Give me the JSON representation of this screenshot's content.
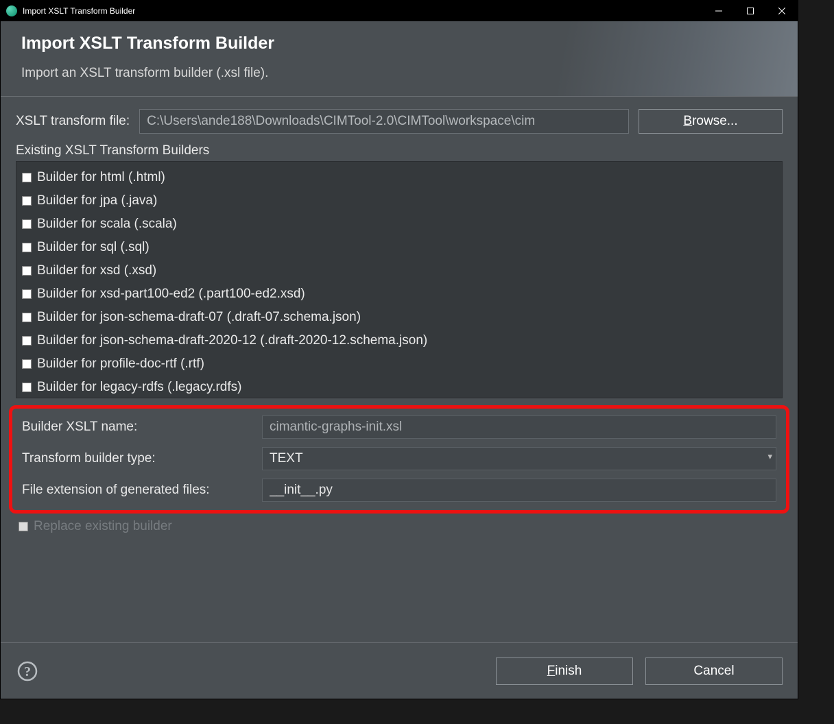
{
  "window": {
    "title": "Import XSLT Transform Builder"
  },
  "header": {
    "title": "Import XSLT Transform Builder",
    "subtitle": "Import an XSLT transform builder (.xsl file)."
  },
  "file_row": {
    "label": "XSLT transform file:",
    "value": "C:\\Users\\ande188\\Downloads\\CIMTool-2.0\\CIMTool\\workspace\\cim",
    "browse_prefix": "B",
    "browse_rest": "rowse..."
  },
  "existing": {
    "label": "Existing XSLT Transform Builders",
    "items": [
      "Builder for html  (.html)",
      "Builder for jpa  (.java)",
      "Builder for scala  (.scala)",
      "Builder for sql  (.sql)",
      "Builder for xsd  (.xsd)",
      "Builder for xsd-part100-ed2  (.part100-ed2.xsd)",
      "Builder for json-schema-draft-07  (.draft-07.schema.json)",
      "Builder for json-schema-draft-2020-12  (.draft-2020-12.schema.json)",
      "Builder for profile-doc-rtf  (.rtf)",
      "Builder for legacy-rdfs  (.legacy.rdfs)"
    ]
  },
  "form": {
    "xslt_name_label": "Builder XSLT name:",
    "xslt_name_value": "cimantic-graphs-init.xsl",
    "type_label": "Transform builder type:",
    "type_value": "TEXT",
    "ext_label": "File extension of generated files:",
    "ext_value": "__init__.py"
  },
  "replace": {
    "label": "Replace existing builder"
  },
  "footer": {
    "finish_prefix": "F",
    "finish_rest": "inish",
    "cancel": "Cancel"
  }
}
